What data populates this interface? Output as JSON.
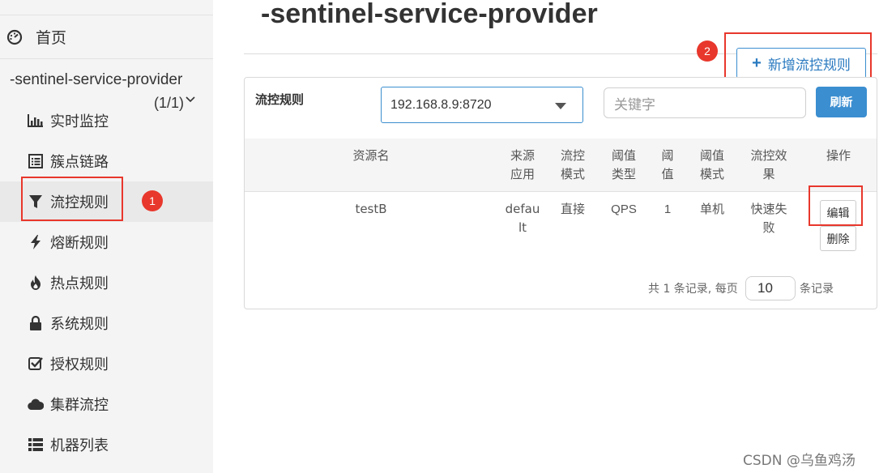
{
  "sidebar": {
    "home": {
      "label": "首页",
      "icon": "dashboard-icon"
    },
    "app": {
      "name": "-sentinel-service-provider",
      "count": "(1/1)"
    },
    "items": [
      {
        "label": "实时监控",
        "icon": "bar-chart-icon"
      },
      {
        "label": "簇点链路",
        "icon": "list-icon"
      },
      {
        "label": "流控规则",
        "icon": "filter-icon",
        "active": true
      },
      {
        "label": "熔断规则",
        "icon": "bolt-icon"
      },
      {
        "label": "热点规则",
        "icon": "fire-icon"
      },
      {
        "label": "系统规则",
        "icon": "lock-icon"
      },
      {
        "label": "授权规则",
        "icon": "check-square-icon"
      },
      {
        "label": "集群流控",
        "icon": "cloud-icon"
      },
      {
        "label": "机器列表",
        "icon": "th-list-icon"
      }
    ]
  },
  "annotations": {
    "badge1": "1",
    "badge2": "2"
  },
  "main": {
    "title": "-sentinel-service-provider",
    "add_button": {
      "label": "新增流控规则"
    },
    "panel": {
      "title": "流控规则",
      "machine_select": "192.168.8.9:8720",
      "search_placeholder": "关键字",
      "refresh_label": "刷新",
      "columns": [
        "资源名",
        "来源应用",
        "流控模式",
        "阈值类型",
        "阈值",
        "阈值模式",
        "流控效果",
        "操作"
      ],
      "rows": [
        {
          "resource": "testB",
          "limit_app": "default",
          "strategy": "直接",
          "grade": "QPS",
          "count": "1",
          "cluster_mode": "单机",
          "control_behavior": "快速失败",
          "edit_label": "编辑",
          "delete_label": "删除"
        }
      ],
      "pager": {
        "total_text": "共 1 条记录, 每页",
        "page_size": "10",
        "suffix": "条记录"
      }
    }
  },
  "watermark": "CSDN @乌鱼鸡汤",
  "colors": {
    "accent": "#3b8ed0",
    "highlight": "#e8372c",
    "sidebar_bg": "#f4f4f4"
  }
}
